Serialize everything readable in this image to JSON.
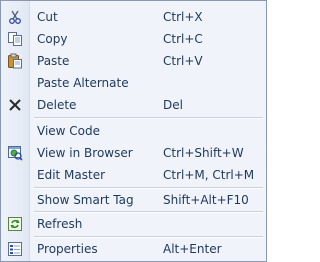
{
  "menu": {
    "items": [
      {
        "label": "Cut",
        "shortcut": "Ctrl+X",
        "icon": "scissors-icon"
      },
      {
        "label": "Copy",
        "shortcut": "Ctrl+C",
        "icon": "copy-icon"
      },
      {
        "label": "Paste",
        "shortcut": "Ctrl+V",
        "icon": "clipboard-icon"
      },
      {
        "label": "Paste Alternate",
        "shortcut": "",
        "icon": ""
      },
      {
        "label": "Delete",
        "shortcut": "Del",
        "icon": "delete-x-icon"
      },
      {
        "label": "View Code",
        "shortcut": "",
        "icon": ""
      },
      {
        "label": "View in Browser",
        "shortcut": "Ctrl+Shift+W",
        "icon": "browser-icon"
      },
      {
        "label": "Edit Master",
        "shortcut": "Ctrl+M, Ctrl+M",
        "icon": ""
      },
      {
        "label": "Show Smart Tag",
        "shortcut": "Shift+Alt+F10",
        "icon": ""
      },
      {
        "label": "Refresh",
        "shortcut": "",
        "icon": "refresh-icon"
      },
      {
        "label": "Properties",
        "shortcut": "Alt+Enter",
        "icon": "properties-icon"
      }
    ]
  },
  "colors": {
    "menu_background": "#f0f3f9",
    "border": "#8a99b3",
    "text": "#1e395b"
  }
}
